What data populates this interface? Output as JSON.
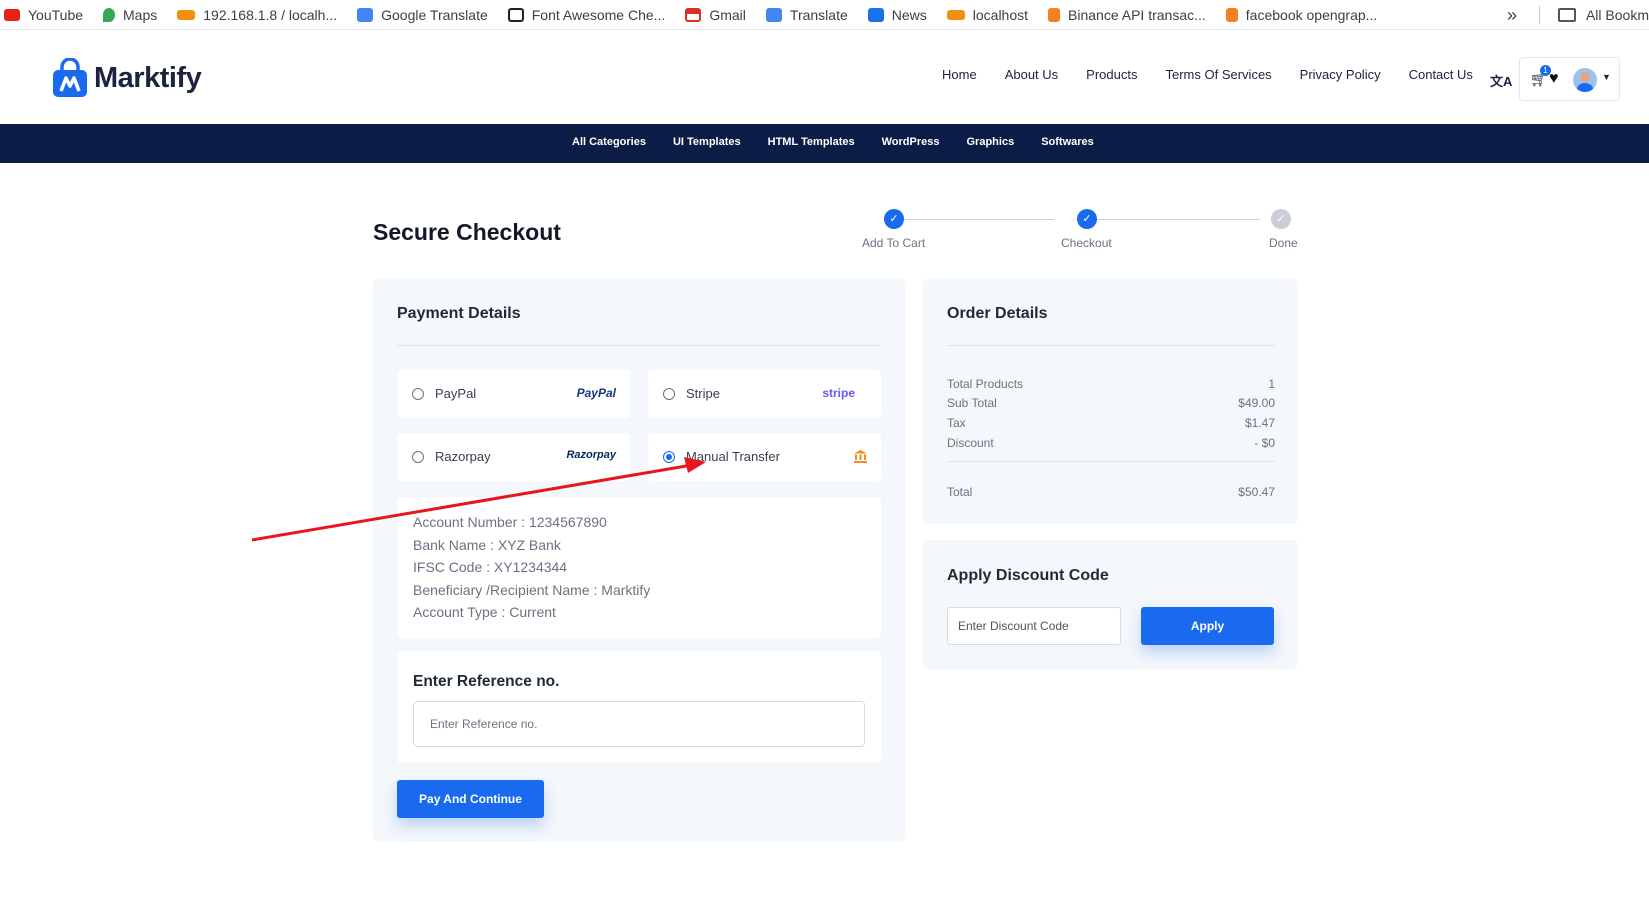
{
  "bookmarks": {
    "items": [
      {
        "label": "YouTube",
        "icon": "youtube-icon",
        "color": "#e62117"
      },
      {
        "label": "Maps",
        "icon": "maps-icon",
        "color": "#34a853"
      },
      {
        "label": "192.168.1.8 / localh...",
        "icon": "phpmyadmin-icon",
        "color": "#f29111"
      },
      {
        "label": "Google Translate",
        "icon": "translate-icon",
        "color": "#4285f4"
      },
      {
        "label": "Font Awesome Che...",
        "icon": "flag-icon",
        "color": "#222222"
      },
      {
        "label": "Gmail",
        "icon": "gmail-icon",
        "color": "#d93025"
      },
      {
        "label": "Translate",
        "icon": "translate-icon",
        "color": "#4285f4"
      },
      {
        "label": "News",
        "icon": "news-icon",
        "color": "#1a73e8"
      },
      {
        "label": "localhost",
        "icon": "phpmyadmin-icon",
        "color": "#f29111"
      },
      {
        "label": "Binance API transac...",
        "icon": "stackoverflow-icon",
        "color": "#f48024"
      },
      {
        "label": "facebook opengrap...",
        "icon": "stackoverflow-icon",
        "color": "#f48024"
      }
    ],
    "more": "»",
    "all_bookmarks": "All Bookm"
  },
  "header": {
    "logo_text": "Marktify",
    "nav": [
      "Home",
      "About Us",
      "Products",
      "Terms Of Services",
      "Privacy Policy",
      "Contact Us"
    ],
    "cart_count": "1",
    "accent": "#1a6af0"
  },
  "categories": [
    "All Categories",
    "UI Templates",
    "HTML Templates",
    "WordPress",
    "Graphics",
    "Softwares"
  ],
  "checkout": {
    "title": "Secure Checkout",
    "steps": [
      {
        "label": "Add To Cart",
        "done": true
      },
      {
        "label": "Checkout",
        "done": true
      },
      {
        "label": "Done",
        "done": false
      }
    ]
  },
  "payment": {
    "title": "Payment Details",
    "options": [
      {
        "label": "PayPal",
        "brand": "PayPal",
        "selected": false
      },
      {
        "label": "Stripe",
        "brand": "stripe",
        "selected": false
      },
      {
        "label": "Razorpay",
        "brand": "Razorpay",
        "selected": false
      },
      {
        "label": "Manual Transfer",
        "brand": "bank-icon",
        "selected": true
      }
    ],
    "bank_details": [
      "Account Number : 1234567890",
      "Bank Name : XYZ Bank",
      "IFSC Code : XY1234344",
      "Beneficiary /Recipient Name : Marktify",
      "Account Type  : Current"
    ],
    "reference_title": "Enter Reference no.",
    "reference_placeholder": "Enter Reference no.",
    "pay_button": "Pay And Continue"
  },
  "order": {
    "title": "Order Details",
    "rows": [
      {
        "label": "Total Products",
        "value": "1"
      },
      {
        "label": "Sub Total",
        "value": "$49.00"
      },
      {
        "label": "Tax",
        "value": "$1.47"
      },
      {
        "label": "Discount",
        "value": "- $0"
      }
    ],
    "total_label": "Total",
    "total_value": "$50.47"
  },
  "discount": {
    "title": "Apply Discount Code",
    "placeholder": "Enter Discount Code",
    "apply_button": "Apply"
  }
}
